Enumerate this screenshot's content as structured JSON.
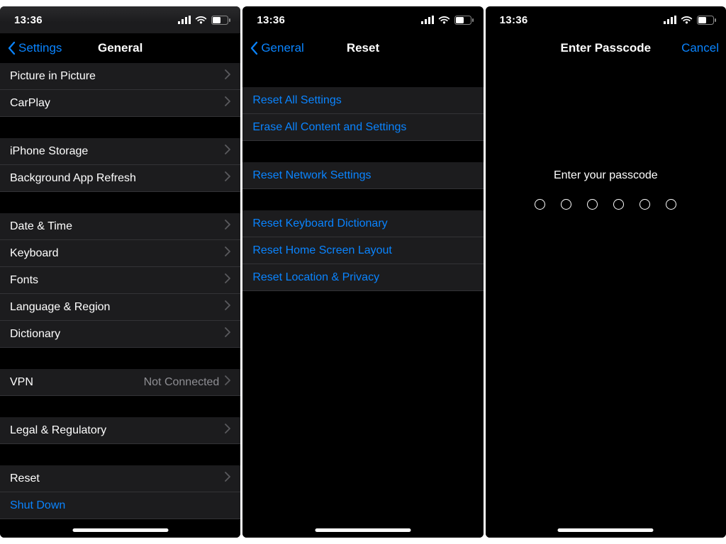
{
  "colors": {
    "accent": "#0a84ff",
    "cell": "#1c1c1e",
    "secondary": "#8e8e93"
  },
  "status": {
    "time": "13:36"
  },
  "screen1": {
    "back": "Settings",
    "title": "General",
    "groups": [
      {
        "rows": [
          {
            "label": "Picture in Picture",
            "chevron": true
          },
          {
            "label": "CarPlay",
            "chevron": true
          }
        ]
      },
      {
        "rows": [
          {
            "label": "iPhone Storage",
            "chevron": true
          },
          {
            "label": "Background App Refresh",
            "chevron": true
          }
        ]
      },
      {
        "rows": [
          {
            "label": "Date & Time",
            "chevron": true
          },
          {
            "label": "Keyboard",
            "chevron": true
          },
          {
            "label": "Fonts",
            "chevron": true
          },
          {
            "label": "Language & Region",
            "chevron": true
          },
          {
            "label": "Dictionary",
            "chevron": true
          }
        ]
      },
      {
        "rows": [
          {
            "label": "VPN",
            "value": "Not Connected",
            "chevron": true
          }
        ]
      },
      {
        "rows": [
          {
            "label": "Legal & Regulatory",
            "chevron": true
          }
        ]
      },
      {
        "rows": [
          {
            "label": "Reset",
            "chevron": true
          },
          {
            "label": "Shut Down",
            "link": true
          }
        ]
      }
    ]
  },
  "screen2": {
    "back": "General",
    "title": "Reset",
    "groups": [
      {
        "rows": [
          {
            "label": "Reset All Settings",
            "link": true
          },
          {
            "label": "Erase All Content and Settings",
            "link": true
          }
        ]
      },
      {
        "rows": [
          {
            "label": "Reset Network Settings",
            "link": true
          }
        ]
      },
      {
        "rows": [
          {
            "label": "Reset Keyboard Dictionary",
            "link": true
          },
          {
            "label": "Reset Home Screen Layout",
            "link": true
          },
          {
            "label": "Reset Location & Privacy",
            "link": true
          }
        ]
      }
    ]
  },
  "screen3": {
    "title": "Enter Passcode",
    "cancel": "Cancel",
    "prompt": "Enter your passcode",
    "digits": 6
  }
}
